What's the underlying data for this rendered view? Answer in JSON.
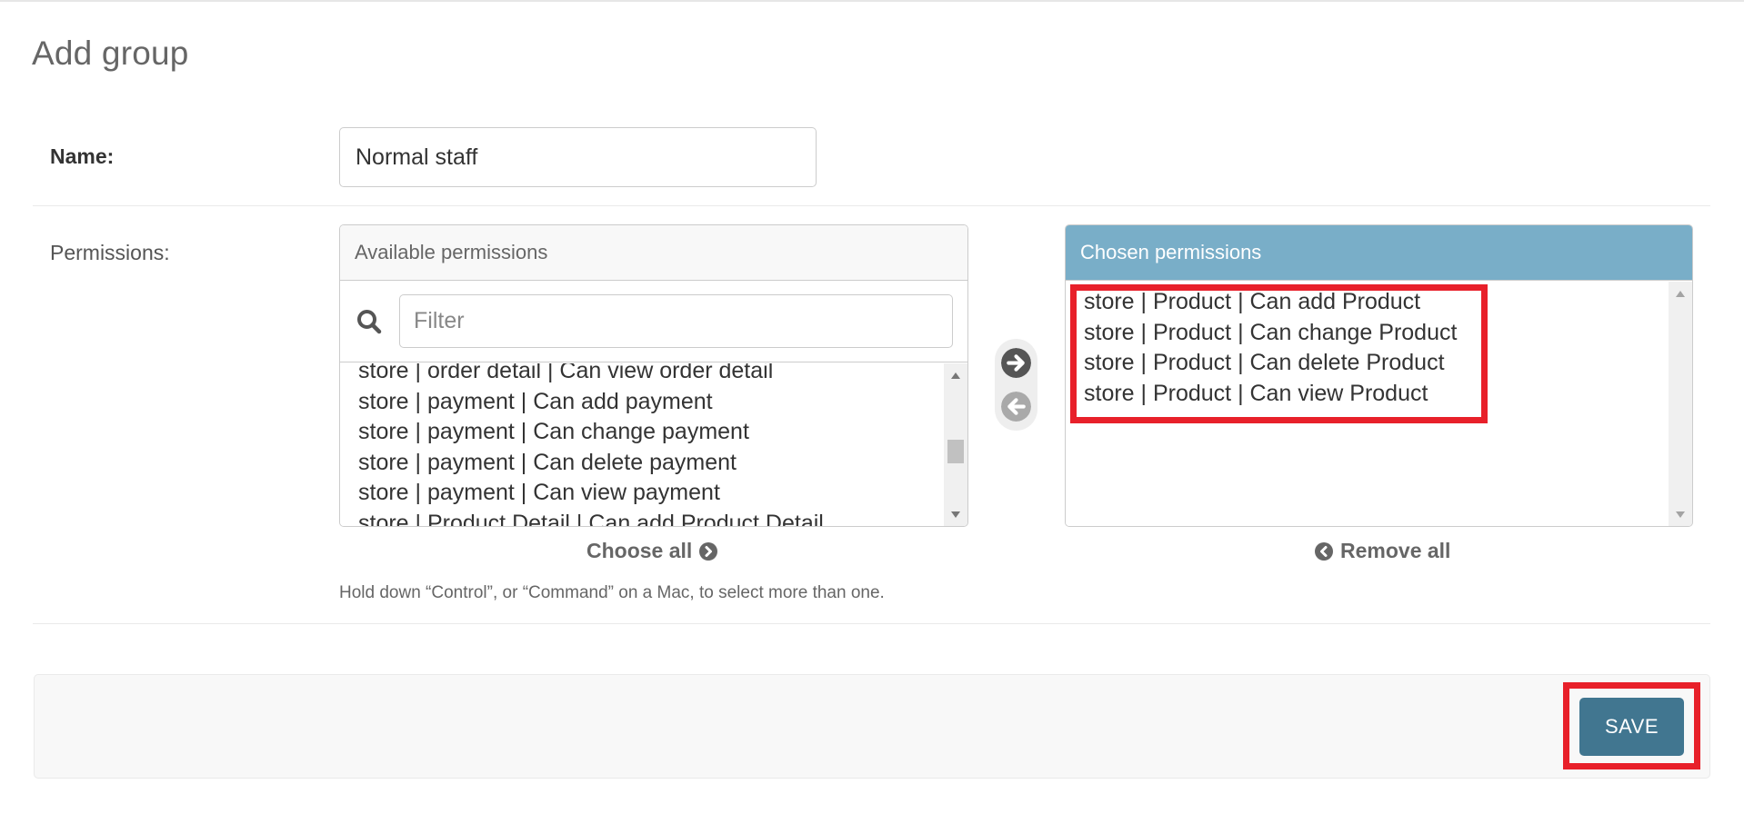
{
  "page": {
    "title": "Add group"
  },
  "form": {
    "name_label": "Name:",
    "name_value": "Normal staff",
    "permissions_label": "Permissions:"
  },
  "available": {
    "header": "Available permissions",
    "filter_placeholder": "Filter",
    "filter_value": "",
    "items": [
      "store | order detail | Can view order detail",
      "store | payment | Can add payment",
      "store | payment | Can change payment",
      "store | payment | Can delete payment",
      "store | payment | Can view payment",
      "store | Product Detail | Can add Product Detail"
    ],
    "choose_all_label": "Choose all"
  },
  "chosen": {
    "header": "Chosen permissions",
    "items": [
      "store | Product | Can add Product",
      "store | Product | Can change Product",
      "store | Product | Can delete Product",
      "store | Product | Can view Product"
    ],
    "remove_all_label": "Remove all"
  },
  "help_text": "Hold down “Control”, or “Command” on a Mac, to select more than one.",
  "submit": {
    "save_label": "SAVE"
  },
  "icons": {
    "search": "search-icon",
    "choose": "arrow-right-circle-icon",
    "remove": "arrow-left-circle-icon",
    "choose_all": "chevron-right-circle-icon",
    "remove_all": "chevron-left-circle-icon"
  },
  "colors": {
    "chosen_header": "#79aec8",
    "save_button": "#417690",
    "highlight": "#e8202a"
  }
}
